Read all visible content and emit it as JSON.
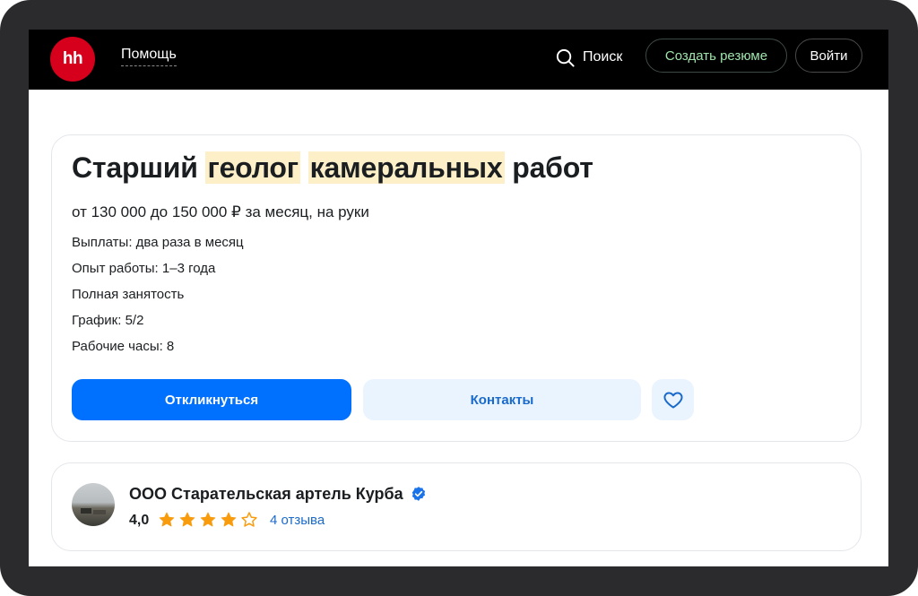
{
  "header": {
    "logo_text": "hh",
    "help_label": "Помощь",
    "search_label": "Поиск",
    "create_resume_label": "Создать резюме",
    "login_label": "Войти"
  },
  "vacancy": {
    "title_part1": "Старший",
    "title_hl1": "геолог",
    "title_hl2": "камеральных",
    "title_part2": "работ",
    "salary": "от 130 000 до 150 000 ₽ за месяц, на руки",
    "details": [
      "Выплаты: два раза в месяц",
      "Опыт работы: 1–3 года",
      "Полная занятость",
      "График: 5/2",
      "Рабочие часы: 8"
    ],
    "apply_label": "Откликнуться",
    "contacts_label": "Контакты"
  },
  "company": {
    "name": "ООО Старательская артель Курба",
    "rating": "4,0",
    "rating_stars": 4,
    "rating_max": 5,
    "reviews_label": "4 отзыва"
  },
  "colors": {
    "header_bg": "#000000",
    "logo_red": "#d6001c",
    "accent_blue": "#0070ff",
    "star_orange": "#f89c0e",
    "highlight": "#fdf0c8",
    "create_resume_green": "#9fe3ad"
  },
  "icons": {
    "search": "search-icon",
    "favorite": "heart-icon",
    "verified": "verified-check-icon",
    "star": "star-icon"
  }
}
